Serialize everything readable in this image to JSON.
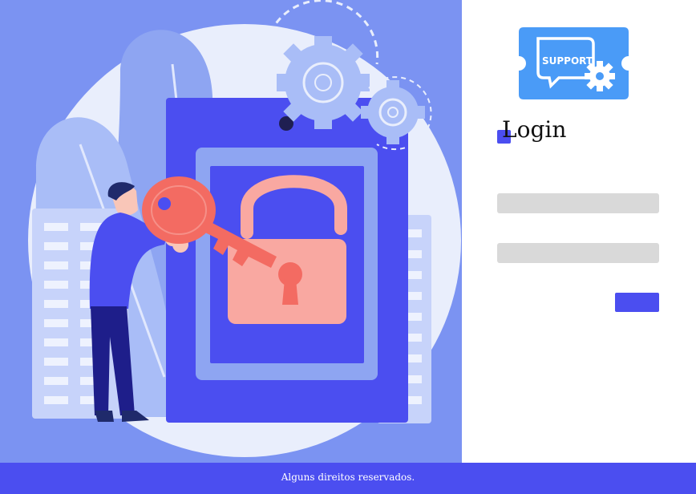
{
  "login": {
    "title": "Login",
    "username_value": "",
    "password_value": "",
    "submit_label": ""
  },
  "logo": {
    "text": "SUPPORT",
    "icons": [
      "speech-bubble-icon",
      "gear-icon"
    ]
  },
  "illustration": {
    "subject": "person-with-key-and-padlock"
  },
  "footer": {
    "text": "Alguns direitos reservados."
  },
  "colors": {
    "hero_background": "#7b93f2",
    "accent": "#4b4ef0",
    "logo_blue": "#4a9bf7",
    "field_gray": "#d9d9d9",
    "lock_pink": "#f9a8a1",
    "key_coral": "#f36b62"
  }
}
